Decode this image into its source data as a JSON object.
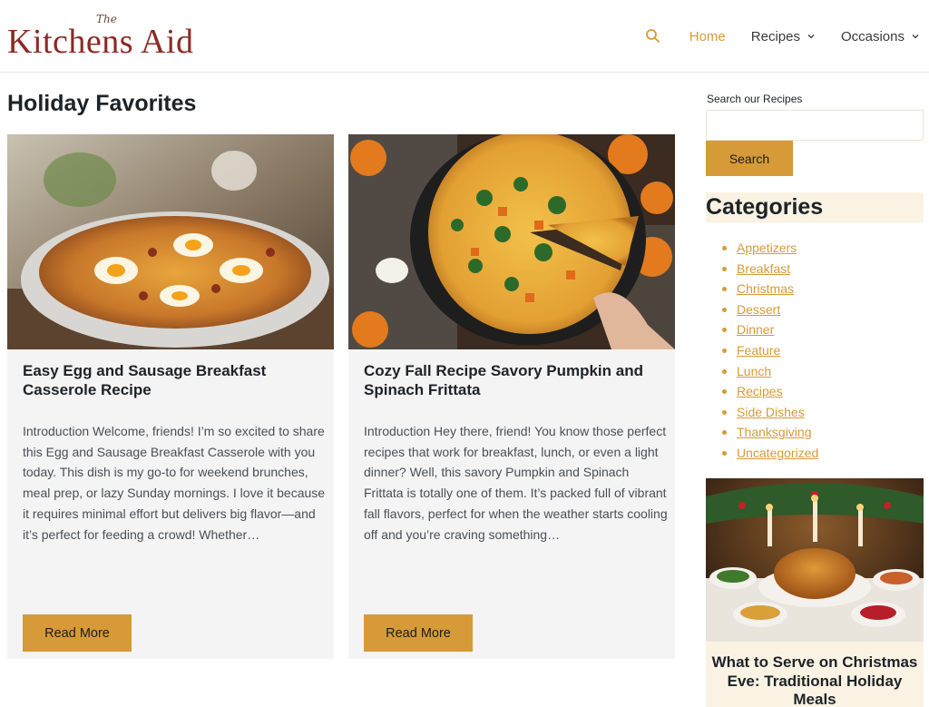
{
  "site": {
    "logo_small": "The",
    "logo_main": "Kitchens Aid",
    "colors": {
      "accent": "#d69a38",
      "brand": "#8a2a24",
      "card_bg": "#f4f4f5",
      "highlight_bg": "#faf3e3"
    }
  },
  "nav": {
    "search_icon": "search-icon",
    "items": [
      {
        "label": "Home",
        "active": true
      },
      {
        "label": "Recipes",
        "has_dropdown": true
      },
      {
        "label": "Occasions",
        "has_dropdown": true
      }
    ]
  },
  "main": {
    "title": "Holiday Favorites",
    "posts": [
      {
        "title": "Easy Egg and Sausage Breakfast Casserole Recipe",
        "excerpt": "Introduction Welcome, friends! I’m so excited to share this Egg and Sausage Breakfast Casserole with you today. This dish is my go-to for weekend brunches, meal prep, or lazy Sunday mornings. I love it because it requires minimal effort but delivers big flavor—and it’s perfect for feeding a crowd! Whether…",
        "button": "Read More"
      },
      {
        "title": "Cozy Fall Recipe Savory Pumpkin and Spinach Frittata",
        "excerpt": "Introduction Hey there, friend! You know those perfect recipes that work for breakfast, lunch, or even a light dinner? Well, this savory Pumpkin and Spinach Frittata is totally one of them. It’s packed full of vibrant fall flavors, perfect for when the weather starts cooling off and you’re craving something…",
        "button": "Read More"
      }
    ]
  },
  "sidebar": {
    "search_label": "Search our Recipes",
    "search_value": "",
    "search_button": "Search",
    "categories_heading": "Categories",
    "categories": [
      "Appetizers",
      "Breakfast",
      "Christmas",
      "Dessert",
      "Dinner",
      "Feature",
      "Lunch",
      "Recipes",
      "Side Dishes",
      "Thanksgiving",
      "Uncategorized"
    ],
    "featured_title": "What to Serve on Christmas Eve: Traditional Holiday Meals"
  }
}
